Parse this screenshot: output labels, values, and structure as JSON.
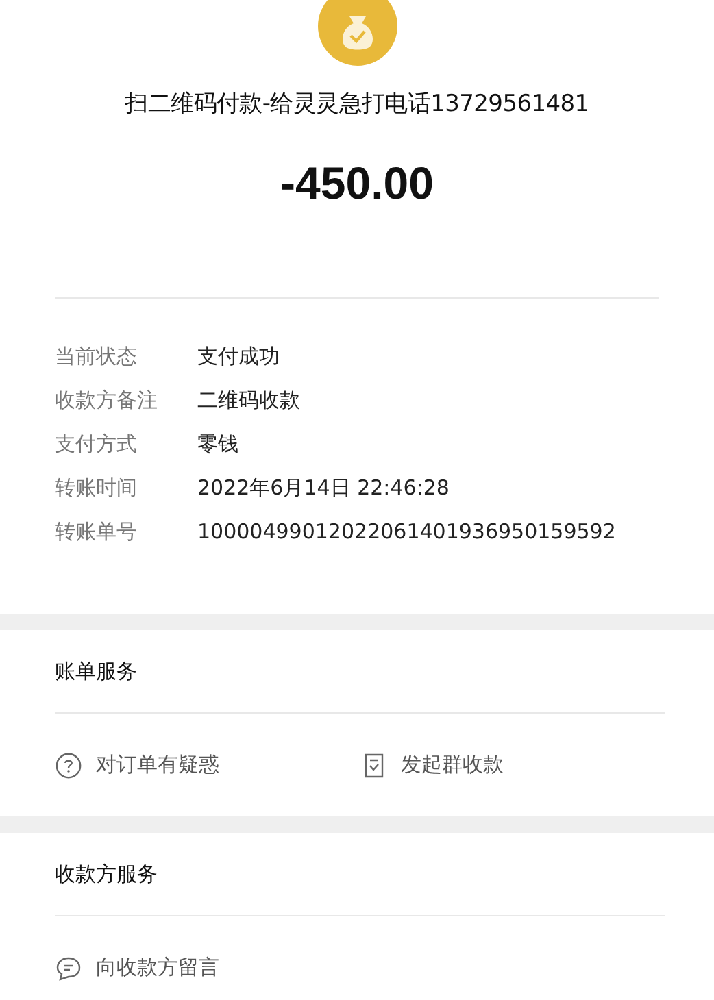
{
  "header": {
    "title": "扫二维码付款-给灵灵急打电话13729561481",
    "amount": "-450.00"
  },
  "details": [
    {
      "label": "当前状态",
      "value": "支付成功"
    },
    {
      "label": "收款方备注",
      "value": "二维码收款"
    },
    {
      "label": "支付方式",
      "value": "零钱"
    },
    {
      "label": "转账时间",
      "value": "2022年6月14日 22:46:28"
    },
    {
      "label": "转账单号",
      "value": "10000499012022061401936950159592"
    }
  ],
  "sections": [
    {
      "title": "账单服务",
      "actions": [
        {
          "kind": "question",
          "label": "对订单有疑惑"
        },
        {
          "kind": "bill",
          "label": "发起群收款"
        }
      ]
    },
    {
      "title": "收款方服务",
      "actions": [
        {
          "kind": "message",
          "label": "向收款方留言"
        }
      ]
    }
  ]
}
